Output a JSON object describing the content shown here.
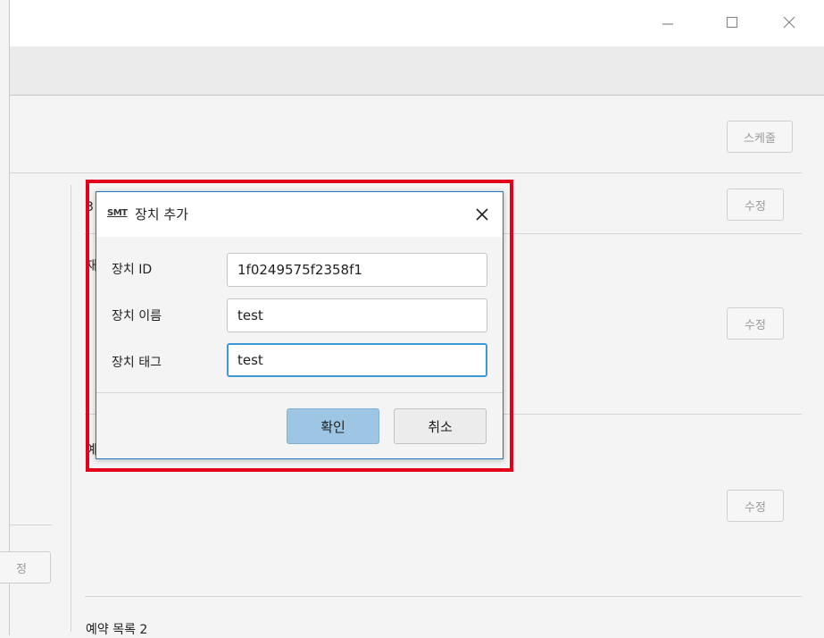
{
  "window": {
    "controls": {
      "minimize": "minimize-icon",
      "maximize": "maximize-icon",
      "close": "close-icon"
    }
  },
  "background": {
    "schedule_button": "스케줄",
    "edit_button_label": "수정",
    "partial_left_button": "정",
    "partial_letter_1": "3",
    "partial_letter_2": "재",
    "partial_letter_3": "예",
    "section_label": "예약 목록 2"
  },
  "dialog": {
    "logo": "SMT",
    "title": "장치 추가",
    "fields": [
      {
        "label": "장치 ID",
        "value": "1f0249575f2358f1"
      },
      {
        "label": "장치 이름",
        "value": "test"
      },
      {
        "label": "장치 태그",
        "value": "test"
      }
    ],
    "ok_label": "확인",
    "cancel_label": "취소"
  },
  "colors": {
    "highlight": "#e3001b",
    "dialog_border": "#1a79c9",
    "focus_border": "#3c99d6",
    "ok_button": "#9cc6e4"
  }
}
